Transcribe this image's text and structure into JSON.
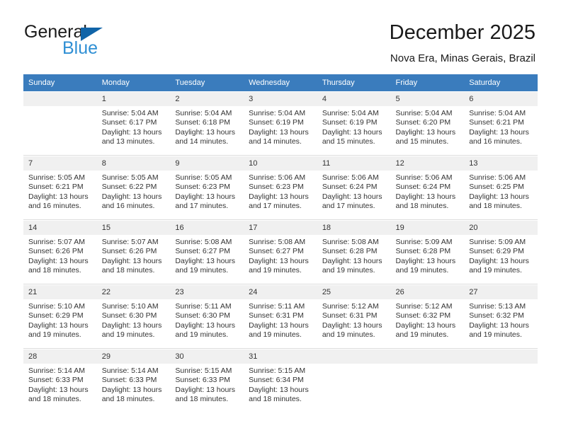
{
  "brand": {
    "name_dark": "General",
    "name_blue": "Blue",
    "triangle_color": "#1064a8",
    "blue_color": "#2f8fd4"
  },
  "header": {
    "title": "December 2025",
    "subtitle": "Nova Era, Minas Gerais, Brazil"
  },
  "theme": {
    "header_bg": "#3a7cbd",
    "header_text": "#ffffff",
    "daynum_bg": "#f0f0f0",
    "body_text": "#333333"
  },
  "calendar": {
    "weekday_headers": [
      "Sunday",
      "Monday",
      "Tuesday",
      "Wednesday",
      "Thursday",
      "Friday",
      "Saturday"
    ],
    "weeks": [
      [
        {
          "day": "",
          "sunrise": "",
          "sunset": "",
          "daylight_line1": "",
          "daylight_line2": ""
        },
        {
          "day": "1",
          "sunrise": "Sunrise: 5:04 AM",
          "sunset": "Sunset: 6:17 PM",
          "daylight_line1": "Daylight: 13 hours",
          "daylight_line2": "and 13 minutes."
        },
        {
          "day": "2",
          "sunrise": "Sunrise: 5:04 AM",
          "sunset": "Sunset: 6:18 PM",
          "daylight_line1": "Daylight: 13 hours",
          "daylight_line2": "and 14 minutes."
        },
        {
          "day": "3",
          "sunrise": "Sunrise: 5:04 AM",
          "sunset": "Sunset: 6:19 PM",
          "daylight_line1": "Daylight: 13 hours",
          "daylight_line2": "and 14 minutes."
        },
        {
          "day": "4",
          "sunrise": "Sunrise: 5:04 AM",
          "sunset": "Sunset: 6:19 PM",
          "daylight_line1": "Daylight: 13 hours",
          "daylight_line2": "and 15 minutes."
        },
        {
          "day": "5",
          "sunrise": "Sunrise: 5:04 AM",
          "sunset": "Sunset: 6:20 PM",
          "daylight_line1": "Daylight: 13 hours",
          "daylight_line2": "and 15 minutes."
        },
        {
          "day": "6",
          "sunrise": "Sunrise: 5:04 AM",
          "sunset": "Sunset: 6:21 PM",
          "daylight_line1": "Daylight: 13 hours",
          "daylight_line2": "and 16 minutes."
        }
      ],
      [
        {
          "day": "7",
          "sunrise": "Sunrise: 5:05 AM",
          "sunset": "Sunset: 6:21 PM",
          "daylight_line1": "Daylight: 13 hours",
          "daylight_line2": "and 16 minutes."
        },
        {
          "day": "8",
          "sunrise": "Sunrise: 5:05 AM",
          "sunset": "Sunset: 6:22 PM",
          "daylight_line1": "Daylight: 13 hours",
          "daylight_line2": "and 16 minutes."
        },
        {
          "day": "9",
          "sunrise": "Sunrise: 5:05 AM",
          "sunset": "Sunset: 6:23 PM",
          "daylight_line1": "Daylight: 13 hours",
          "daylight_line2": "and 17 minutes."
        },
        {
          "day": "10",
          "sunrise": "Sunrise: 5:06 AM",
          "sunset": "Sunset: 6:23 PM",
          "daylight_line1": "Daylight: 13 hours",
          "daylight_line2": "and 17 minutes."
        },
        {
          "day": "11",
          "sunrise": "Sunrise: 5:06 AM",
          "sunset": "Sunset: 6:24 PM",
          "daylight_line1": "Daylight: 13 hours",
          "daylight_line2": "and 17 minutes."
        },
        {
          "day": "12",
          "sunrise": "Sunrise: 5:06 AM",
          "sunset": "Sunset: 6:24 PM",
          "daylight_line1": "Daylight: 13 hours",
          "daylight_line2": "and 18 minutes."
        },
        {
          "day": "13",
          "sunrise": "Sunrise: 5:06 AM",
          "sunset": "Sunset: 6:25 PM",
          "daylight_line1": "Daylight: 13 hours",
          "daylight_line2": "and 18 minutes."
        }
      ],
      [
        {
          "day": "14",
          "sunrise": "Sunrise: 5:07 AM",
          "sunset": "Sunset: 6:26 PM",
          "daylight_line1": "Daylight: 13 hours",
          "daylight_line2": "and 18 minutes."
        },
        {
          "day": "15",
          "sunrise": "Sunrise: 5:07 AM",
          "sunset": "Sunset: 6:26 PM",
          "daylight_line1": "Daylight: 13 hours",
          "daylight_line2": "and 18 minutes."
        },
        {
          "day": "16",
          "sunrise": "Sunrise: 5:08 AM",
          "sunset": "Sunset: 6:27 PM",
          "daylight_line1": "Daylight: 13 hours",
          "daylight_line2": "and 19 minutes."
        },
        {
          "day": "17",
          "sunrise": "Sunrise: 5:08 AM",
          "sunset": "Sunset: 6:27 PM",
          "daylight_line1": "Daylight: 13 hours",
          "daylight_line2": "and 19 minutes."
        },
        {
          "day": "18",
          "sunrise": "Sunrise: 5:08 AM",
          "sunset": "Sunset: 6:28 PM",
          "daylight_line1": "Daylight: 13 hours",
          "daylight_line2": "and 19 minutes."
        },
        {
          "day": "19",
          "sunrise": "Sunrise: 5:09 AM",
          "sunset": "Sunset: 6:28 PM",
          "daylight_line1": "Daylight: 13 hours",
          "daylight_line2": "and 19 minutes."
        },
        {
          "day": "20",
          "sunrise": "Sunrise: 5:09 AM",
          "sunset": "Sunset: 6:29 PM",
          "daylight_line1": "Daylight: 13 hours",
          "daylight_line2": "and 19 minutes."
        }
      ],
      [
        {
          "day": "21",
          "sunrise": "Sunrise: 5:10 AM",
          "sunset": "Sunset: 6:29 PM",
          "daylight_line1": "Daylight: 13 hours",
          "daylight_line2": "and 19 minutes."
        },
        {
          "day": "22",
          "sunrise": "Sunrise: 5:10 AM",
          "sunset": "Sunset: 6:30 PM",
          "daylight_line1": "Daylight: 13 hours",
          "daylight_line2": "and 19 minutes."
        },
        {
          "day": "23",
          "sunrise": "Sunrise: 5:11 AM",
          "sunset": "Sunset: 6:30 PM",
          "daylight_line1": "Daylight: 13 hours",
          "daylight_line2": "and 19 minutes."
        },
        {
          "day": "24",
          "sunrise": "Sunrise: 5:11 AM",
          "sunset": "Sunset: 6:31 PM",
          "daylight_line1": "Daylight: 13 hours",
          "daylight_line2": "and 19 minutes."
        },
        {
          "day": "25",
          "sunrise": "Sunrise: 5:12 AM",
          "sunset": "Sunset: 6:31 PM",
          "daylight_line1": "Daylight: 13 hours",
          "daylight_line2": "and 19 minutes."
        },
        {
          "day": "26",
          "sunrise": "Sunrise: 5:12 AM",
          "sunset": "Sunset: 6:32 PM",
          "daylight_line1": "Daylight: 13 hours",
          "daylight_line2": "and 19 minutes."
        },
        {
          "day": "27",
          "sunrise": "Sunrise: 5:13 AM",
          "sunset": "Sunset: 6:32 PM",
          "daylight_line1": "Daylight: 13 hours",
          "daylight_line2": "and 19 minutes."
        }
      ],
      [
        {
          "day": "28",
          "sunrise": "Sunrise: 5:14 AM",
          "sunset": "Sunset: 6:33 PM",
          "daylight_line1": "Daylight: 13 hours",
          "daylight_line2": "and 18 minutes."
        },
        {
          "day": "29",
          "sunrise": "Sunrise: 5:14 AM",
          "sunset": "Sunset: 6:33 PM",
          "daylight_line1": "Daylight: 13 hours",
          "daylight_line2": "and 18 minutes."
        },
        {
          "day": "30",
          "sunrise": "Sunrise: 5:15 AM",
          "sunset": "Sunset: 6:33 PM",
          "daylight_line1": "Daylight: 13 hours",
          "daylight_line2": "and 18 minutes."
        },
        {
          "day": "31",
          "sunrise": "Sunrise: 5:15 AM",
          "sunset": "Sunset: 6:34 PM",
          "daylight_line1": "Daylight: 13 hours",
          "daylight_line2": "and 18 minutes."
        },
        {
          "day": "",
          "sunrise": "",
          "sunset": "",
          "daylight_line1": "",
          "daylight_line2": ""
        },
        {
          "day": "",
          "sunrise": "",
          "sunset": "",
          "daylight_line1": "",
          "daylight_line2": ""
        },
        {
          "day": "",
          "sunrise": "",
          "sunset": "",
          "daylight_line1": "",
          "daylight_line2": ""
        }
      ]
    ]
  }
}
